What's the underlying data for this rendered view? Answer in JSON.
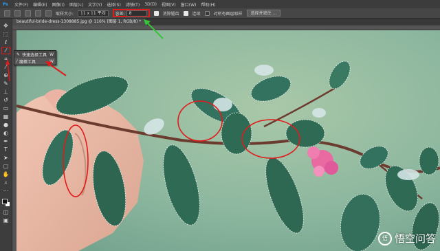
{
  "menubar": {
    "logo": "Ps",
    "items": [
      "文件(F)",
      "编辑(E)",
      "图像(I)",
      "图层(L)",
      "文字(Y)",
      "选择(S)",
      "滤镜(T)",
      "3D(D)",
      "视图(V)",
      "窗口(W)",
      "帮助(H)"
    ]
  },
  "options": {
    "sample_size_label": "取样大小:",
    "sample_size_value": "11 x 11 平均",
    "tolerance_label": "容差:",
    "tolerance_value": "8",
    "antialias_label": "消除锯齿",
    "contiguous_label": "连续",
    "sample_all_label": "对所有图层取样",
    "select_mask_label": "选择并遮住 ..."
  },
  "document": {
    "tab_title": "beautiful-bride-dress-1308885.jpg @ 116% (图层 1, RGB/8) *"
  },
  "flyout": {
    "items": [
      {
        "label": "快速选择工具",
        "shortcut": "W"
      },
      {
        "label": "魔棒工具",
        "shortcut": "W"
      }
    ]
  },
  "watermark": {
    "logo_text": "悟",
    "text": "悟空问答"
  },
  "colors": {
    "annotation_red": "#e01b1b",
    "annotation_green": "#38c43a",
    "background_green": "#8eb59c"
  }
}
